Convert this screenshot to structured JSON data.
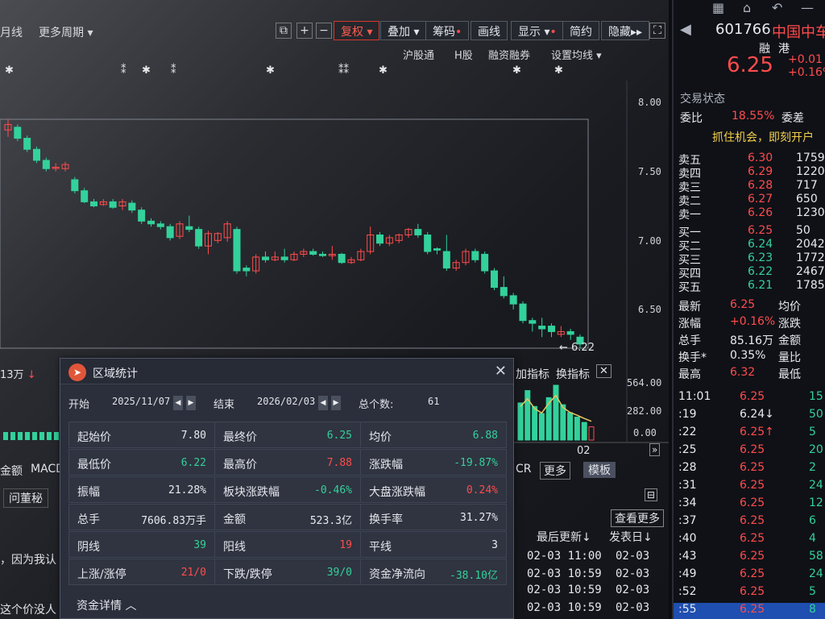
{
  "toolbar": {
    "period_month": "月线",
    "more_period": "更多周期",
    "restore_rights": "复权",
    "overlay": "叠加",
    "chips": "筹码",
    "draw_line": "画线",
    "display": "显示",
    "simple": "简约",
    "hide": "隐藏"
  },
  "subbar": {
    "hgt": "沪股通",
    "h_share": "H股",
    "margin": "融资融券",
    "set_ma": "设置均线"
  },
  "price_axis": [
    "8.00",
    "7.50",
    "7.00",
    "6.50"
  ],
  "volume_axis": [
    "564.00",
    "282.00",
    "0.00"
  ],
  "date_label_02": "02",
  "last_price_marker": "6.22",
  "indicator_bar": {
    "vol_label": "13万",
    "add_indicator": "加指标",
    "switch_indicator": "换指标"
  },
  "chart_data": {
    "type": "candlestick",
    "ylim": [
      6.0,
      8.2
    ],
    "candles": [
      {
        "o": 7.8,
        "c": 7.84,
        "h": 7.88,
        "l": 7.75
      },
      {
        "o": 7.82,
        "c": 7.74,
        "h": 7.84,
        "l": 7.72
      },
      {
        "o": 7.74,
        "c": 7.66,
        "h": 7.76,
        "l": 7.64
      },
      {
        "o": 7.66,
        "c": 7.58,
        "h": 7.68,
        "l": 7.56
      },
      {
        "o": 7.58,
        "c": 7.52,
        "h": 7.6,
        "l": 7.5
      },
      {
        "o": 7.53,
        "c": 7.53,
        "h": 7.56,
        "l": 7.5
      },
      {
        "o": 7.52,
        "c": 7.55,
        "h": 7.57,
        "l": 7.5
      },
      {
        "o": 7.44,
        "c": 7.36,
        "h": 7.46,
        "l": 7.34
      },
      {
        "o": 7.36,
        "c": 7.28,
        "h": 7.38,
        "l": 7.27
      },
      {
        "o": 7.28,
        "c": 7.25,
        "h": 7.3,
        "l": 7.24
      },
      {
        "o": 7.26,
        "c": 7.28,
        "h": 7.3,
        "l": 7.25
      },
      {
        "o": 7.28,
        "c": 7.24,
        "h": 7.3,
        "l": 7.23
      },
      {
        "o": 7.25,
        "c": 7.28,
        "h": 7.3,
        "l": 7.22
      },
      {
        "o": 7.27,
        "c": 7.22,
        "h": 7.29,
        "l": 7.2
      },
      {
        "o": 7.22,
        "c": 7.14,
        "h": 7.24,
        "l": 7.12
      },
      {
        "o": 7.14,
        "c": 7.12,
        "h": 7.16,
        "l": 7.1
      },
      {
        "o": 7.12,
        "c": 7.1,
        "h": 7.14,
        "l": 7.08
      },
      {
        "o": 7.1,
        "c": 7.02,
        "h": 7.12,
        "l": 7.0
      },
      {
        "o": 7.03,
        "c": 7.12,
        "h": 7.14,
        "l": 7.01
      },
      {
        "o": 7.1,
        "c": 7.08,
        "h": 7.18,
        "l": 7.06
      },
      {
        "o": 7.08,
        "c": 6.96,
        "h": 7.1,
        "l": 6.94
      },
      {
        "o": 6.96,
        "c": 7.05,
        "h": 7.07,
        "l": 6.9
      },
      {
        "o": 7.0,
        "c": 7.05,
        "h": 7.06,
        "l": 6.98
      },
      {
        "o": 7.02,
        "c": 7.12,
        "h": 7.14,
        "l": 6.99
      },
      {
        "o": 7.08,
        "c": 6.78,
        "h": 7.1,
        "l": 6.76
      },
      {
        "o": 6.8,
        "c": 6.78,
        "h": 6.82,
        "l": 6.74
      },
      {
        "o": 6.78,
        "c": 6.88,
        "h": 6.9,
        "l": 6.76
      },
      {
        "o": 6.88,
        "c": 6.86,
        "h": 6.92,
        "l": 6.84
      },
      {
        "o": 6.86,
        "c": 6.88,
        "h": 6.92,
        "l": 6.85
      },
      {
        "o": 6.88,
        "c": 6.86,
        "h": 6.94,
        "l": 6.84
      },
      {
        "o": 6.86,
        "c": 6.9,
        "h": 6.92,
        "l": 6.85
      },
      {
        "o": 6.9,
        "c": 6.92,
        "h": 6.94,
        "l": 6.88
      },
      {
        "o": 6.92,
        "c": 6.9,
        "h": 6.94,
        "l": 6.89
      },
      {
        "o": 6.9,
        "c": 6.89,
        "h": 6.92,
        "l": 6.88
      },
      {
        "o": 6.89,
        "c": 6.9,
        "h": 6.96,
        "l": 6.86
      },
      {
        "o": 6.9,
        "c": 6.84,
        "h": 6.91,
        "l": 6.83
      },
      {
        "o": 6.84,
        "c": 6.86,
        "h": 6.88,
        "l": 6.83
      },
      {
        "o": 6.86,
        "c": 6.92,
        "h": 6.94,
        "l": 6.85
      },
      {
        "o": 6.92,
        "c": 7.04,
        "h": 7.1,
        "l": 6.9
      },
      {
        "o": 7.04,
        "c": 6.98,
        "h": 7.06,
        "l": 6.96
      },
      {
        "o": 6.98,
        "c": 7.02,
        "h": 7.04,
        "l": 6.96
      },
      {
        "o": 7.0,
        "c": 7.04,
        "h": 7.05,
        "l": 6.98
      },
      {
        "o": 7.04,
        "c": 7.08,
        "h": 7.09,
        "l": 7.02
      },
      {
        "o": 7.08,
        "c": 7.04,
        "h": 7.12,
        "l": 7.02
      },
      {
        "o": 7.04,
        "c": 6.92,
        "h": 7.06,
        "l": 6.9
      },
      {
        "o": 6.94,
        "c": 6.93,
        "h": 6.95,
        "l": 6.9
      },
      {
        "o": 6.92,
        "c": 6.8,
        "h": 7.04,
        "l": 6.78
      },
      {
        "o": 6.8,
        "c": 6.84,
        "h": 6.86,
        "l": 6.78
      },
      {
        "o": 6.84,
        "c": 6.92,
        "h": 6.94,
        "l": 6.82
      },
      {
        "o": 6.92,
        "c": 6.86,
        "h": 6.94,
        "l": 6.84
      },
      {
        "o": 6.9,
        "c": 6.78,
        "h": 6.92,
        "l": 6.76
      },
      {
        "o": 6.78,
        "c": 6.66,
        "h": 6.8,
        "l": 6.64
      },
      {
        "o": 6.66,
        "c": 6.6,
        "h": 6.74,
        "l": 6.58
      },
      {
        "o": 6.6,
        "c": 6.54,
        "h": 6.62,
        "l": 6.5
      },
      {
        "o": 6.54,
        "c": 6.42,
        "h": 6.56,
        "l": 6.4
      },
      {
        "o": 6.42,
        "c": 6.4,
        "h": 6.44,
        "l": 6.34
      },
      {
        "o": 6.38,
        "c": 6.36,
        "h": 6.44,
        "l": 6.3
      },
      {
        "o": 6.38,
        "c": 6.34,
        "h": 6.4,
        "l": 6.3
      },
      {
        "o": 6.32,
        "c": 6.34,
        "h": 6.38,
        "l": 6.3
      },
      {
        "o": 6.34,
        "c": 6.32,
        "h": 6.36,
        "l": 6.28
      },
      {
        "o": 6.3,
        "c": 6.25,
        "h": 6.32,
        "l": 6.22
      }
    ]
  },
  "quote": {
    "code": "601766",
    "name": "中国中车",
    "tag_rong": "融",
    "tag_gang": "港",
    "price": "6.25",
    "change": "+0.01",
    "change_pct": "+0.16%",
    "trade_state": "交易状态",
    "weibi_label": "委比",
    "weibi_value": "18.55%",
    "weicha_label": "委差",
    "ad": "抓住机会，即刻开户",
    "asks": [
      {
        "label": "卖五",
        "price": "6.30",
        "vol": "1759"
      },
      {
        "label": "卖四",
        "price": "6.29",
        "vol": "1220"
      },
      {
        "label": "卖三",
        "price": "6.28",
        "vol": "717"
      },
      {
        "label": "卖二",
        "price": "6.27",
        "vol": "650"
      },
      {
        "label": "卖一",
        "price": "6.26",
        "vol": "1230"
      }
    ],
    "bids": [
      {
        "label": "买一",
        "price": "6.25",
        "vol": "50"
      },
      {
        "label": "买二",
        "price": "6.24",
        "vol": "2042"
      },
      {
        "label": "买三",
        "price": "6.23",
        "vol": "1772"
      },
      {
        "label": "买四",
        "price": "6.22",
        "vol": "2467"
      },
      {
        "label": "买五",
        "price": "6.21",
        "vol": "1785"
      }
    ],
    "stats": [
      {
        "l1": "最新",
        "v1": "6.25",
        "l2": "均价"
      },
      {
        "l1": "涨幅",
        "v1": "+0.16%",
        "l2": "涨跌"
      },
      {
        "l1": "总手",
        "v1": "85.16万",
        "l2": "金额"
      },
      {
        "l1": "换手*",
        "v1": "0.35%",
        "l2": "量比"
      },
      {
        "l1": "最高",
        "v1": "6.32",
        "l2": "最低"
      }
    ],
    "ticks": [
      {
        "t": "11:01",
        "p": "6.25",
        "v": "15"
      },
      {
        "t": ":19",
        "p": "6.24↓",
        "v": "50"
      },
      {
        "t": ":22",
        "p": "6.25↑",
        "v": "5"
      },
      {
        "t": ":25",
        "p": "6.25",
        "v": "20"
      },
      {
        "t": ":28",
        "p": "6.25",
        "v": "2"
      },
      {
        "t": ":31",
        "p": "6.25",
        "v": "24"
      },
      {
        "t": ":34",
        "p": "6.25",
        "v": "12"
      },
      {
        "t": ":37",
        "p": "6.25",
        "v": "6"
      },
      {
        "t": ":40",
        "p": "6.25",
        "v": "4"
      },
      {
        "t": ":43",
        "p": "6.25",
        "v": "58"
      },
      {
        "t": ":49",
        "p": "6.25",
        "v": "24"
      },
      {
        "t": ":52",
        "p": "6.25",
        "v": "5"
      },
      {
        "t": ":55",
        "p": "6.25",
        "v": "8"
      }
    ]
  },
  "dialog": {
    "title": "区域统计",
    "start_label": "开始",
    "start_date": "2025/11/07",
    "end_label": "结束",
    "end_date": "2026/02/03",
    "total_label": "总个数:",
    "total_value": "61",
    "rows": [
      [
        {
          "l": "起始价",
          "v": "7.80",
          "c": "white"
        },
        {
          "l": "最终价",
          "v": "6.25",
          "c": "green"
        },
        {
          "l": "均价",
          "v": "6.88",
          "c": "green"
        }
      ],
      [
        {
          "l": "最低价",
          "v": "6.22",
          "c": "green"
        },
        {
          "l": "最高价",
          "v": "7.88",
          "c": "red"
        },
        {
          "l": "涨跌幅",
          "v": "-19.87%",
          "c": "green"
        }
      ],
      [
        {
          "l": "振幅",
          "v": "21.28%",
          "c": "white"
        },
        {
          "l": "板块涨跌幅",
          "v": "-0.46%",
          "c": "green"
        },
        {
          "l": "大盘涨跌幅",
          "v": "0.24%",
          "c": "red"
        }
      ],
      [
        {
          "l": "总手",
          "v": "7606.83万手",
          "c": "white"
        },
        {
          "l": "金额",
          "v": "523.3亿",
          "c": "white"
        },
        {
          "l": "换手率",
          "v": "31.27%",
          "c": "white"
        }
      ],
      [
        {
          "l": "阴线",
          "v": "39",
          "c": "green"
        },
        {
          "l": "阳线",
          "v": "19",
          "c": "red"
        },
        {
          "l": "平线",
          "v": "3",
          "c": "white"
        }
      ],
      [
        {
          "l": "上涨/涨停",
          "v": "21/0",
          "c": "red"
        },
        {
          "l": "下跌/跌停",
          "v": "39/0",
          "c": "green"
        },
        {
          "l": "资金净流向",
          "v": "-38.10亿",
          "c": "green"
        }
      ]
    ],
    "fund_detail": "资金详情"
  },
  "lower_left": {
    "amount": "金额",
    "macd": "MACD",
    "ask_board": "问董秘",
    "news1": "，因为我认",
    "news2": "这个价没人"
  },
  "lower_right": {
    "cr": "CR",
    "more": "更多",
    "template": "模板",
    "view_more": "查看更多",
    "last_update": "最后更新↓",
    "publish_date": "发表日↓",
    "news_rows": [
      {
        "u": "02-03 11:00",
        "d": "02-03"
      },
      {
        "u": "02-03 10:59",
        "d": "02-03"
      },
      {
        "u": "02-03 10:59",
        "d": "02-03"
      },
      {
        "u": "02-03 10:59",
        "d": "02-03"
      }
    ]
  },
  "colors": {
    "up": "#ff4c4c",
    "down": "#33d19b",
    "accent": "#d9372e"
  }
}
